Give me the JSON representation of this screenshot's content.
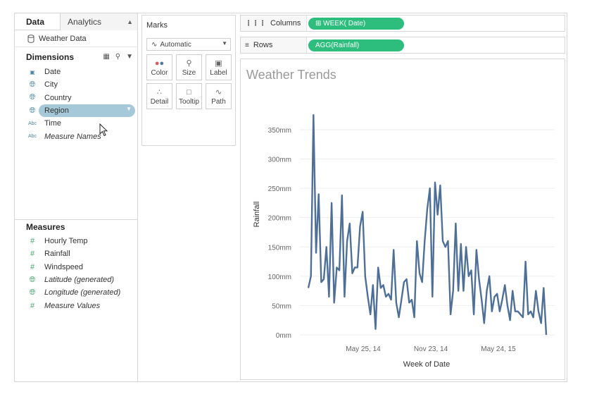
{
  "tabs": {
    "data": "Data",
    "analytics": "Analytics"
  },
  "datasource": {
    "name": "Weather Data",
    "icon": "database-icon"
  },
  "dimensions": {
    "title": "Dimensions",
    "fields": [
      {
        "name": "Date",
        "type": "date"
      },
      {
        "name": "City",
        "type": "geo"
      },
      {
        "name": "Country",
        "type": "geo"
      },
      {
        "name": "Region",
        "type": "geo",
        "selected": true
      },
      {
        "name": "Time",
        "type": "abc"
      },
      {
        "name": "Measure Names",
        "type": "abc"
      }
    ]
  },
  "measures": {
    "title": "Measures",
    "fields": [
      {
        "name": "Hourly Temp"
      },
      {
        "name": "Rainfall"
      },
      {
        "name": "Windspeed"
      },
      {
        "name": "Latitude (generated)"
      },
      {
        "name": "Longitude (generated)"
      },
      {
        "name": "Measure Values"
      }
    ]
  },
  "marks": {
    "title": "Marks",
    "type": "Automatic",
    "buttons": [
      "Color",
      "Size",
      "Label",
      "Detail",
      "Tooltip",
      "Path"
    ]
  },
  "shelves": {
    "columns_label": "Columns",
    "columns_pill": "WEEK( Date)",
    "rows_label": "Rows",
    "rows_pill": "AGG(Rainfall)",
    "pill_color": "#2dbe7d"
  },
  "colors": {
    "line": "#4e6f97",
    "selected_pill": "#a6c9d9",
    "grid": "#eeeeee"
  },
  "chart_data": {
    "type": "line",
    "title": "Weather Trends",
    "xlabel": "Week of Date",
    "ylabel": "Rainfall",
    "x_ticks": [
      "May 25, 14",
      "Nov 23, 14",
      "May 24, 15"
    ],
    "y_ticks": [
      "0mm",
      "50mm",
      "100mm",
      "150mm",
      "200mm",
      "250mm",
      "300mm",
      "350mm"
    ],
    "ylim": [
      0,
      380
    ],
    "grid": true,
    "series": [
      {
        "values": [
          80,
          100,
          375,
          140,
          240,
          90,
          95,
          150,
          65,
          225,
          55,
          115,
          110,
          238,
          65,
          160,
          190,
          105,
          115,
          115,
          185,
          210,
          100,
          65,
          35,
          85,
          10,
          115,
          80,
          85,
          65,
          70,
          60,
          145,
          55,
          30,
          60,
          90,
          95,
          55,
          60,
          30,
          160,
          105,
          90,
          160,
          215,
          250,
          65,
          260,
          205,
          255,
          160,
          150,
          160,
          35,
          75,
          190,
          75,
          155,
          75,
          150,
          100,
          110,
          35,
          145,
          95,
          60,
          20,
          75,
          100,
          40,
          65,
          70,
          40,
          60,
          85,
          50,
          25,
          75,
          40,
          40,
          35,
          30,
          125,
          35,
          40,
          30,
          75,
          40,
          20,
          80,
          0
        ]
      }
    ]
  }
}
